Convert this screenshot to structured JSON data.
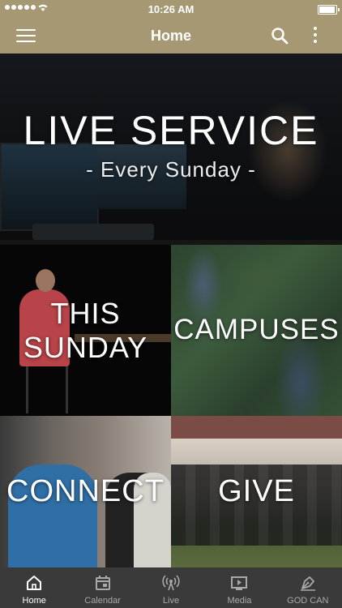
{
  "status_bar": {
    "time": "10:26 AM"
  },
  "header": {
    "title": "Home",
    "menu_icon": "hamburger-menu-icon",
    "search_icon": "search-icon",
    "more_icon": "more-vertical-icon"
  },
  "tiles": {
    "hero": {
      "title": "LIVE SERVICE",
      "subtitle": "- Every Sunday -"
    },
    "this_sunday": {
      "line1": "THIS",
      "line2": "SUNDAY"
    },
    "campuses": {
      "label": "CAMPUSES"
    },
    "connect": {
      "label": "CONNECT"
    },
    "give": {
      "label": "GIVE"
    }
  },
  "tab_bar": {
    "items": [
      {
        "label": "Home",
        "icon": "home-icon",
        "active": true
      },
      {
        "label": "Calendar",
        "icon": "calendar-icon",
        "active": false
      },
      {
        "label": "Live",
        "icon": "broadcast-icon",
        "active": false
      },
      {
        "label": "Media",
        "icon": "media-play-icon",
        "active": false
      },
      {
        "label": "GOD CAN",
        "icon": "pen-nib-icon",
        "active": false
      }
    ]
  },
  "colors": {
    "accent": "#a79874",
    "tab_bar_bg": "#3a3a3a",
    "tab_inactive": "#a9a9a9"
  }
}
